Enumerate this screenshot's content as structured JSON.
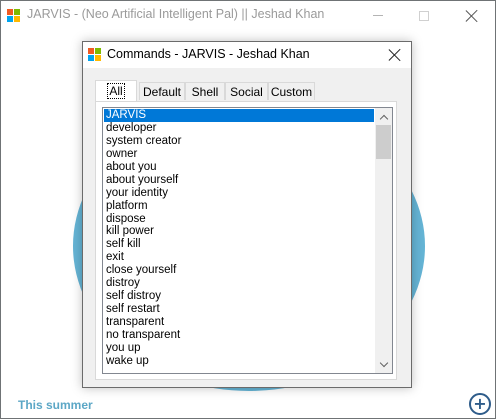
{
  "main_window": {
    "title": "JARVIS - (Neo Artificial Intelligent Pal) || Jeshad Khan",
    "footer_text": "This summer",
    "fab_icon": "plus-circle-icon",
    "accent_color": "#5db0d3"
  },
  "dialog": {
    "title": "Commands - JARVIS - Jeshad Khan",
    "tabs": [
      {
        "label": "All",
        "active": true
      },
      {
        "label": "Default",
        "active": false
      },
      {
        "label": "Shell",
        "active": false
      },
      {
        "label": "Social",
        "active": false
      },
      {
        "label": "Custom",
        "active": false
      }
    ],
    "commands": [
      "JARVIS",
      "developer",
      "system creator",
      "owner",
      "about you",
      "about yourself",
      "your identity",
      "platform",
      "dispose",
      "kill power",
      "self kill",
      "exit",
      "close yourself",
      "distroy",
      "self distroy",
      "self restart",
      "transparent",
      "no transparent",
      "you up",
      "wake up"
    ],
    "selected_command": "JARVIS",
    "selection_color": "#0078d7"
  }
}
